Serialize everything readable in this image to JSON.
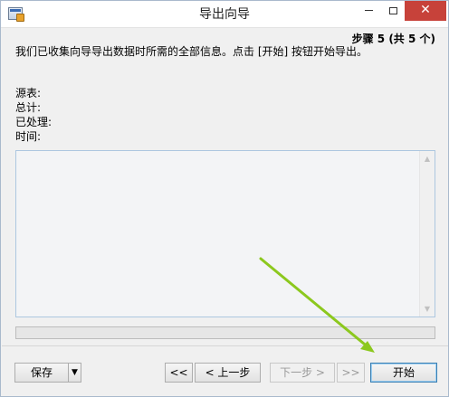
{
  "window": {
    "title": "导出向导",
    "minimize": "",
    "maximize": "",
    "close": "✕"
  },
  "wizard": {
    "step_label": "步骤 5 (共 5 个)",
    "intro": "我们已收集向导导出数据时所需的全部信息。点击 [开始] 按钮开始导出。",
    "info": {
      "source": "源表:",
      "total": "总计:",
      "processed": "已处理:",
      "time": "时间:"
    },
    "log": "",
    "progress": 0
  },
  "buttons": {
    "save": "保存",
    "first": "<<",
    "prev": "< 上一步",
    "next": "下一步 >",
    "last": ">>",
    "start": "开始"
  },
  "colors": {
    "close_button": "#c7423a",
    "annotation_arrow": "#8cc81e",
    "default_button_border": "#3c7fb1"
  }
}
